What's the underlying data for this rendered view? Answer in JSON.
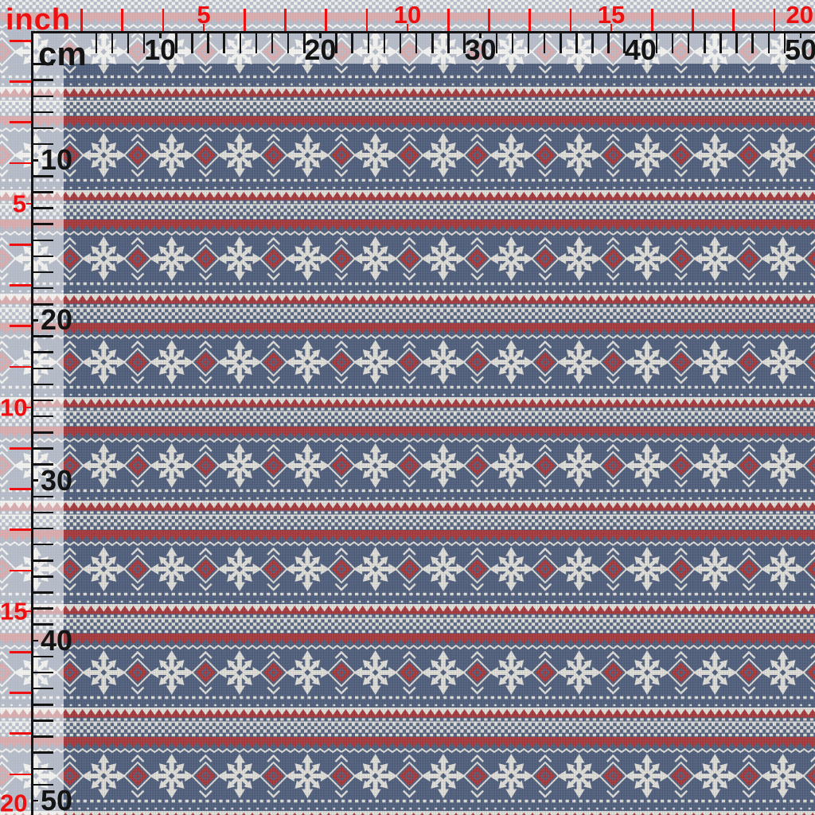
{
  "rulers": {
    "horizontal": {
      "inch_label": "inch",
      "cm_label": "cm",
      "inch_numbers": [
        5,
        10,
        15,
        20
      ],
      "cm_numbers": [
        10,
        20,
        30,
        40,
        50
      ]
    },
    "vertical": {
      "inch_numbers": [
        5,
        10,
        15,
        20
      ],
      "cm_numbers": [
        10,
        20,
        30,
        40,
        50
      ]
    },
    "inch_color": "#ee1010",
    "cm_color": "#141414"
  },
  "fabric": {
    "style": "fair-isle-knit",
    "motifs": [
      "snowflake-star",
      "red-diamond",
      "sawtooth-band",
      "checker-band",
      "zigzag-line",
      "dash-row"
    ],
    "palette": {
      "blue": "#51607d",
      "cream": "#dfded8",
      "red": "#a73a3d"
    }
  }
}
